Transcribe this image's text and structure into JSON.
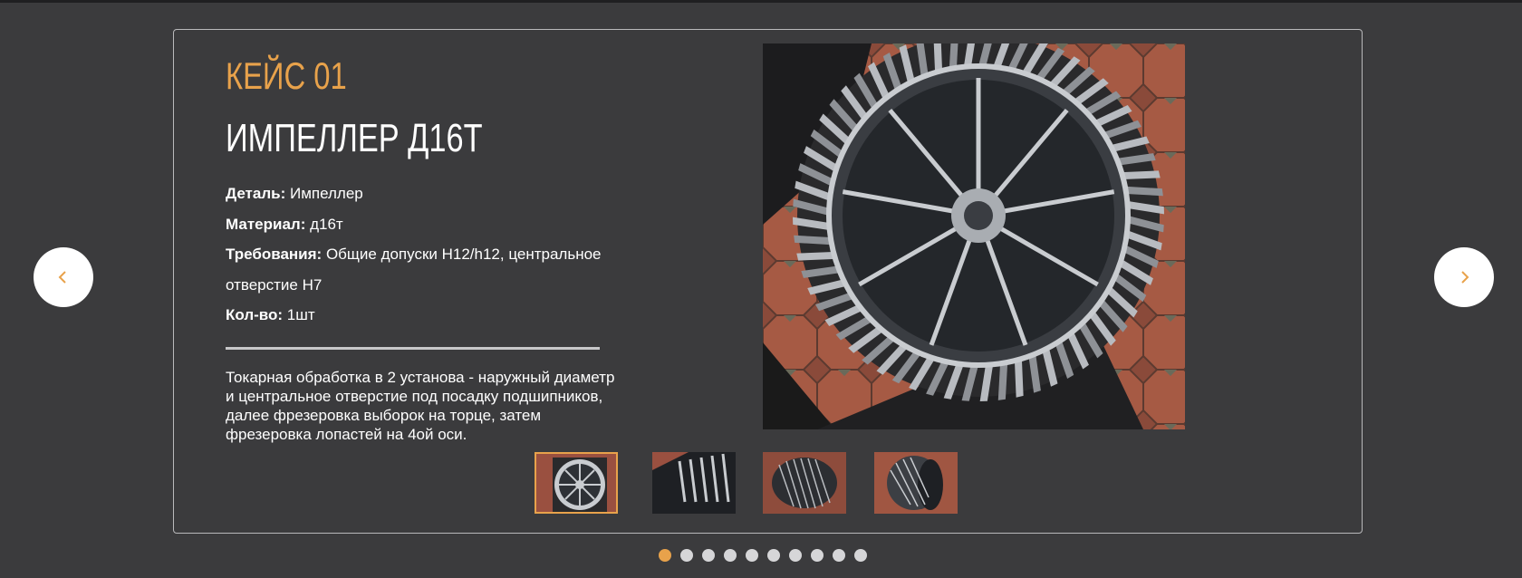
{
  "case": {
    "label": "КЕЙС 01",
    "title": "ИМПЕЛЛЕР Д16Т",
    "specs": [
      {
        "key": "Деталь:",
        "value": " Импеллер"
      },
      {
        "key": "Материал:",
        "value": " д16т"
      },
      {
        "key": "Требования:",
        "value": " Общие допуски H12/h12, центральное"
      },
      {
        "key": "",
        "value": "отверстие H7"
      },
      {
        "key": "Кол-во:",
        "value": " 1шт"
      }
    ],
    "description": "Токарная обработка в 2 установа - наружный диаметр и центральное отверстие под посадку подшипников, далее фрезеровка выборок на торце, затем фрезеровка лопастей на 4ой оси."
  },
  "gallery": {
    "thumbnails": [
      "impeller-front-thumb",
      "impeller-blades-thumb",
      "impeller-side-thumb",
      "impeller-angle-thumb"
    ],
    "active_thumbnail": 0
  },
  "navigation": {
    "prev_icon": "chevron-left-icon",
    "next_icon": "chevron-right-icon",
    "slide_count": 10,
    "active_slide": 1
  },
  "colors": {
    "accent": "#e8a24b",
    "background": "#3b3b3d",
    "text": "#ffffff"
  }
}
